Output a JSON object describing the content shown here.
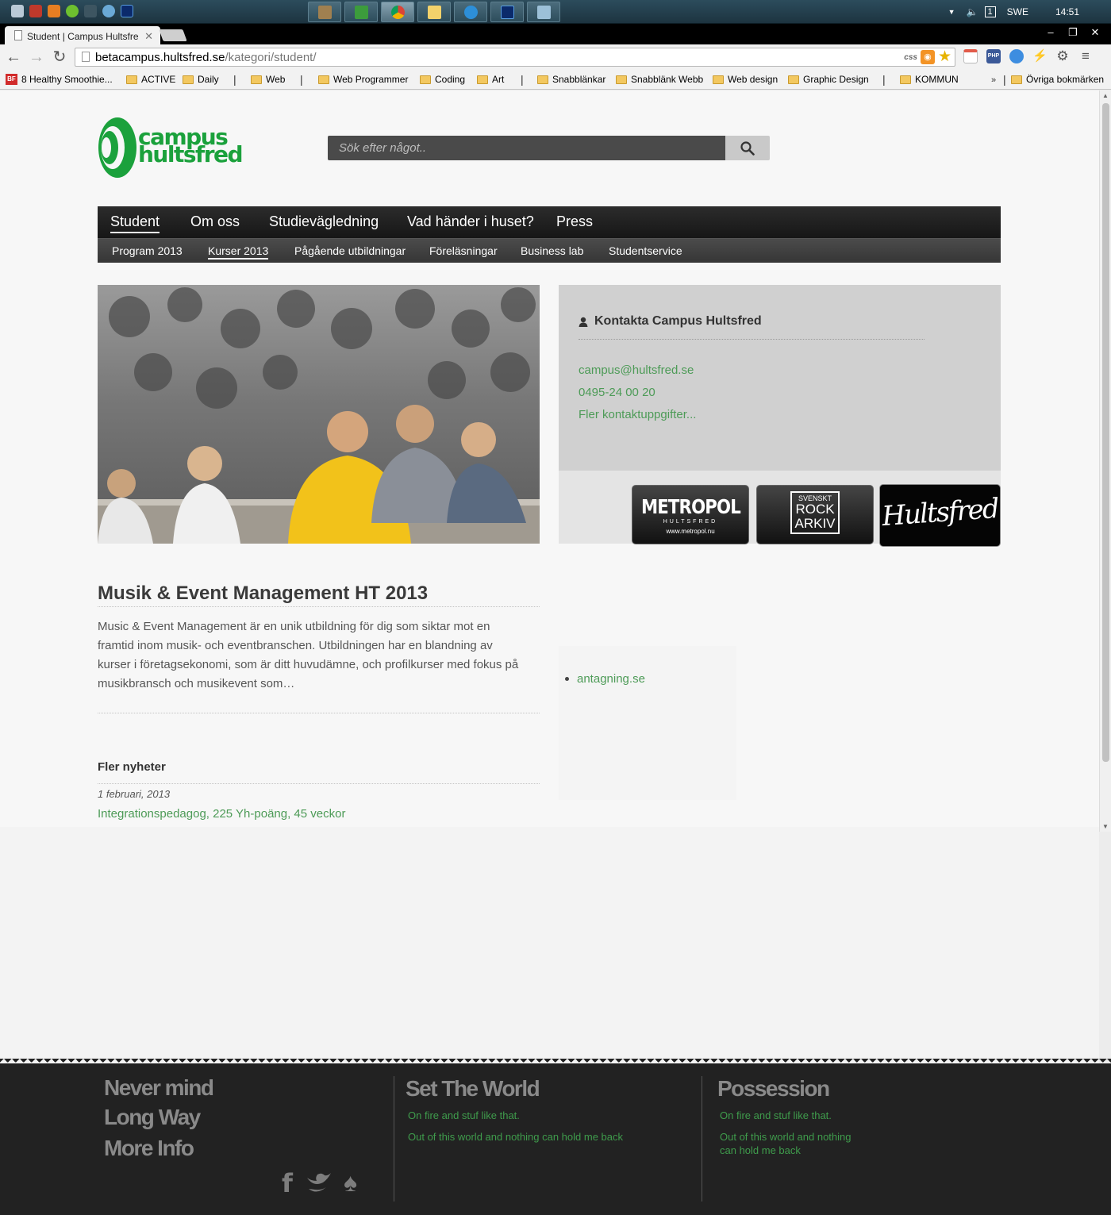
{
  "taskbar": {
    "language": "SWE",
    "clock": "14:51",
    "notification_count": "1"
  },
  "browser": {
    "tab_title": "Student | Campus Hultsfre",
    "url_host": "betacampus.hultsfred.se",
    "url_path": "/kategori/student/",
    "css_badge": "css",
    "ext_php": "PHP",
    "bookmarks": [
      "8 Healthy Smoothie...",
      "ACTIVE",
      "Daily",
      "Web",
      "Web Programmer",
      "Coding",
      "Art",
      "Snabblänkar",
      "Snabblänk Webb",
      "Web design",
      "Graphic Design",
      "KOMMUN"
    ],
    "bookmark_badge": "BF",
    "bookmarks_overflow": "»",
    "other_bookmarks": "Övriga bokmärken"
  },
  "site": {
    "logo_line1": "campus",
    "logo_line2": "hultsfred",
    "search_placeholder": "Sök efter något..",
    "nav_main": [
      "Student",
      "Om oss",
      "Studievägledning",
      "Vad händer i huset?",
      "Press"
    ],
    "nav_sub": [
      "Program 2013",
      "Kurser 2013",
      "Pågående utbildningar",
      "Föreläsningar",
      "Business lab",
      "Studentservice"
    ],
    "contact": {
      "title": "Kontakta Campus Hultsfred",
      "email": "campus@hultsfred.se",
      "phone": "0495-24 00 20",
      "more": "Fler kontaktuppgifter..."
    },
    "partners": {
      "metropol": "METROPOL",
      "metropol_sub": "HULTSFRED",
      "metropol_url": "www.metropol.nu",
      "rock_1": "SVENSKT",
      "rock_2": "ROCK",
      "rock_3": "ARKIV",
      "hultsfred": "Hultsfred"
    },
    "article": {
      "title": "Musik & Event Management HT 2013",
      "body": "Music & Event Management är en unik utbildning för dig som siktar mot en framtid inom musik- och eventbranschen. Utbildningen har en blandning av kurser i företagsekonomi, som är ditt huvudämne, och profilkurser med fokus på musikbransch och musikevent som…"
    },
    "more_news": {
      "title": "Fler nyheter",
      "date": "1 februari, 2013",
      "link": "Integrationspedagog, 225 Yh-poäng, 45 veckor"
    },
    "side_link": "antagning.se",
    "footer": {
      "col1": [
        "Never mind",
        "Long Way",
        "More Info"
      ],
      "col2_title": "Set The World",
      "col2_lines": [
        "On fire and stuf like that.",
        "Out of this world and nothing can hold me back"
      ],
      "col3_title": "Possession",
      "col3_lines": [
        "On fire and stuf like that.",
        "Out of this world and nothing can hold me back"
      ]
    }
  },
  "colors": {
    "accent_green": "#4d9b57",
    "logo_green": "#1ba13c",
    "nav_dark": "#1f1f1f",
    "footer_bg": "#222222"
  }
}
